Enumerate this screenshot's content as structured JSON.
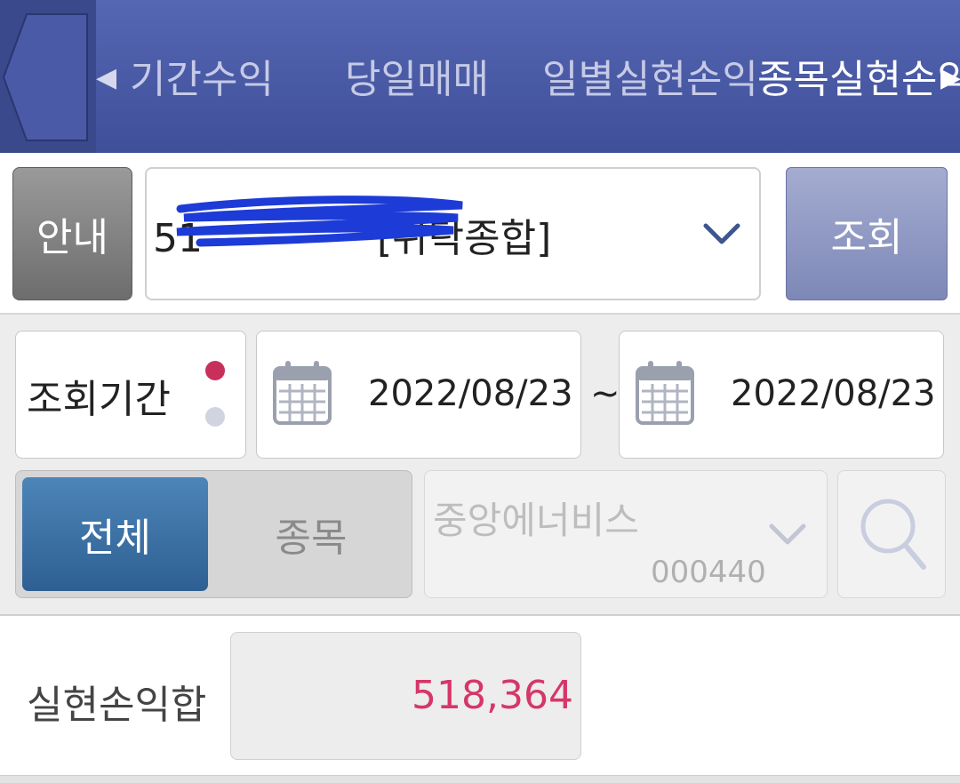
{
  "header": {
    "tabs": [
      {
        "label": "기간수익"
      },
      {
        "label": "당일매매"
      },
      {
        "label": "일별실현손익"
      },
      {
        "label": "종목실현손익"
      }
    ],
    "active_tab_index": 3,
    "prev_arrow": "◀",
    "next_arrow": "▶"
  },
  "account": {
    "guide_label": "안내",
    "account_display": "51",
    "account_suffix": "[위탁종합]",
    "query_label": "조회",
    "chevron_icon": "chevron-down-icon"
  },
  "period": {
    "label": "조회기간",
    "start_date": "2022/08/23",
    "separator": "~",
    "end_date": "2022/08/23",
    "calendar_icon": "calendar-icon"
  },
  "filter": {
    "all_label": "전체",
    "item_label": "종목",
    "selected": "전체",
    "stock_name": "중앙에너비스",
    "stock_code": "000440",
    "search_icon": "search-icon"
  },
  "summary": {
    "label": "실현손익합",
    "value": "518,364"
  },
  "colors": {
    "header_bg": "#4656a3",
    "accent_blue": "#3a6ea3",
    "profit_pink": "#d63668",
    "dot_red": "#c8305c"
  }
}
